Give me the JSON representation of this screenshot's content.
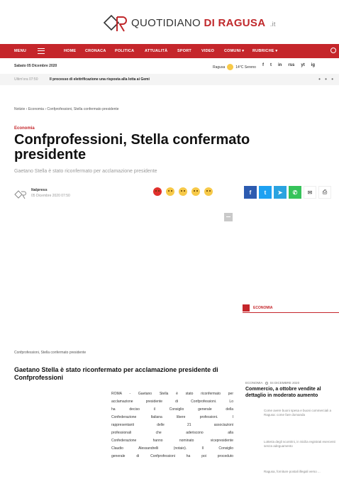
{
  "logo": {
    "text_main": "QUOTIDIANO",
    "text_accent": "DI RAGUSA",
    "text_suffix": ".it"
  },
  "nav": {
    "menu_label": "MENU",
    "items": [
      "HOME",
      "CRONACA",
      "POLITICA",
      "ATTUALITÀ",
      "SPORT",
      "VIDEO",
      "COMUNI ▾",
      "RUBRICHE ▾"
    ]
  },
  "topbar": {
    "date": "Sabato 05 Dicembre 2020",
    "city": "Ragusa",
    "weather": "14°C  Sereno",
    "social": [
      "f",
      "t",
      "in",
      "rss",
      "yt",
      "ig"
    ]
  },
  "ticker": {
    "time": "Ultim'ora 07:50",
    "headline": "Il processo di elettrificazione una risposta alla lotta ai Gemi"
  },
  "breadcrumb": "Notizie  ›  Economia  ›  Confprofessioni, Stella confermato presidente",
  "article": {
    "category": "Economia",
    "title": "Confprofessioni, Stella confermato presidente",
    "subtitle": "Gaetano Stella è stato riconfermato per acclamazione presidente",
    "author_name": "Italpress",
    "author_date": "05 Dicembre 2020 07:50",
    "image_caption": "Confprofessioni, Stella confermato presidente",
    "heading": "Gaetano Stella è stato riconfermato per acclamazione presidente di Confprofessioni",
    "body_lines": [
      "ROMA - Gaetano Stella è stato riconfermato per",
      "acclamazione presidente di Confprofessioni. Lo",
      "ha deciso il Consiglio generale della",
      "Confederazione Italiana libere professioni. I",
      "rappresentanti delle 21 associazioni",
      "professionali che aderiscono alla",
      "Confederazione hanno nominato vicepresidente",
      "Claudio Alessandrelli (notaio). Il Consiglio",
      "generale di Confprofessioni ha poi proceduto"
    ]
  },
  "sidebar": {
    "section": "ECONOMIA",
    "meta_category": "ECONOMIA",
    "meta_date": "04 DICEMBRE 2020",
    "feature_title": "Commercio, a ottobre vendite al dettaglio in moderato aumento",
    "links": [
      "Come avere buoni spesa e buoni commerciali a Ragusa: come fare domanda",
      "Lotteria degli scontrini, in Sicilia registrati esercenti senza adeguamento",
      "Ragusa, forniture postali illegali verso ..."
    ]
  },
  "colors": {
    "brand_red": "#c5262b",
    "facebook": "#2c5bb0",
    "twitter": "#1da1f2",
    "telegram": "#2aa3e0",
    "whatsapp": "#36c35a"
  },
  "share": [
    "f",
    "t",
    "➤",
    "✆",
    "✉",
    "⎙"
  ]
}
